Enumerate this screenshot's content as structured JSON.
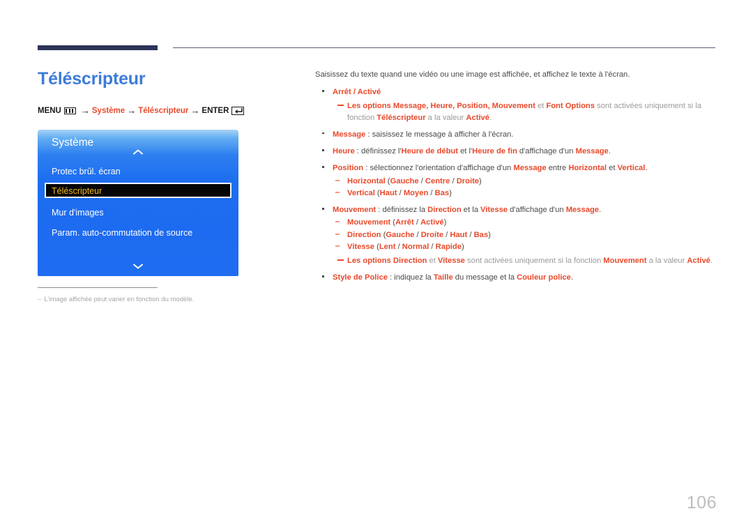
{
  "page_title": "Téléscripteur",
  "menu_path": {
    "menu_label": "MENU",
    "menu_icon": "menu-grid-icon",
    "arrow": "→",
    "step1": "Système",
    "step2": "Téléscripteur",
    "enter_label": "ENTER",
    "enter_icon": "enter-return-icon"
  },
  "osd": {
    "header": "Système",
    "chevron_up_icon": "chevron-up-icon",
    "chevron_down_icon": "chevron-down-icon",
    "items": [
      {
        "label": "Protec brûl. écran",
        "selected": false
      },
      {
        "label": "Téléscripteur",
        "selected": true
      },
      {
        "label": "Mur d'images",
        "selected": false
      },
      {
        "label": "Param. auto-commutation de source",
        "selected": false
      }
    ]
  },
  "footnote": {
    "dash": "‒",
    "text": "L'image affichée peut varier en fonction du modèle."
  },
  "content": {
    "intro": "Saisissez du texte quand une vidéo ou une image est affichée, et affichez le texte à l'écran.",
    "b1_title": "Arrêt / Activé",
    "note1_p1": "Les options Message",
    "note1_p2": ", ",
    "note1_p3": "Heure",
    "note1_p4": ", ",
    "note1_p5": "Position",
    "note1_p6": ", ",
    "note1_p7": "Mouvement",
    "note1_p8": " et ",
    "note1_p9": "Font Options",
    "note1_p10": " sont activées uniquement si la fonction ",
    "note1_p11": "Téléscripteur",
    "note1_p12": " a la valeur ",
    "note1_p13": "Activé",
    "note1_p14": ".",
    "b2_term": "Message",
    "b2_rest": " : saisissez le message à afficher à l'écran.",
    "b3_term": "Heure",
    "b3_t1": " : définissez l'",
    "b3_t2": "Heure de début",
    "b3_t3": " et l'",
    "b3_t4": "Heure de fin",
    "b3_t5": " d'affichage d'un ",
    "b3_t6": "Message",
    "b3_t7": ".",
    "b4_term": "Position",
    "b4_t1": " : sélectionnez l'orientation d'affichage d'un ",
    "b4_t2": "Message",
    "b4_t3": " entre ",
    "b4_t4": "Horizontal",
    "b4_t5": " et ",
    "b4_t6": "Vertical",
    "b4_t7": ".",
    "b4_s1_a": "Horizontal",
    "b4_s1_b": " (",
    "b4_s1_c": "Gauche",
    "b4_s1_d": " / ",
    "b4_s1_e": "Centre",
    "b4_s1_f": " / ",
    "b4_s1_g": "Droite",
    "b4_s1_h": ")",
    "b4_s2_a": "Vertical",
    "b4_s2_b": " (",
    "b4_s2_c": "Haut",
    "b4_s2_d": " / ",
    "b4_s2_e": "Moyen",
    "b4_s2_f": " / ",
    "b4_s2_g": "Bas",
    "b4_s2_h": ")",
    "b5_term": "Mouvement",
    "b5_t1": " : définissez la ",
    "b5_t2": "Direction",
    "b5_t3": " et la ",
    "b5_t4": "Vitesse",
    "b5_t5": " d'affichage d'un ",
    "b5_t6": "Message",
    "b5_t7": ".",
    "b5_s1_a": "Mouvement",
    "b5_s1_b": " (",
    "b5_s1_c": "Arrêt",
    "b5_s1_d": " / ",
    "b5_s1_e": "Activé",
    "b5_s1_f": ")",
    "b5_s2_a": "Direction",
    "b5_s2_b": " (",
    "b5_s2_c": "Gauche",
    "b5_s2_d": " / ",
    "b5_s2_e": "Droite",
    "b5_s2_f": " / ",
    "b5_s2_g": "Haut",
    "b5_s2_h": " / ",
    "b5_s2_i": "Bas",
    "b5_s2_j": ")",
    "b5_s3_a": "Vitesse",
    "b5_s3_b": " (",
    "b5_s3_c": "Lent",
    "b5_s3_d": " / ",
    "b5_s3_e": "Normal",
    "b5_s3_f": " / ",
    "b5_s3_g": "Rapide",
    "b5_s3_h": ")",
    "note2_p1": "Les options Direction",
    "note2_p2": " et ",
    "note2_p3": "Vitesse",
    "note2_p4": " sont activées uniquement si la fonction ",
    "note2_p5": "Mouvement",
    "note2_p6": " a la valeur ",
    "note2_p7": "Activé",
    "note2_p8": ".",
    "b6_term": "Style de Police",
    "b6_t1": " : indiquez la ",
    "b6_t2": "Taille",
    "b6_t3": " du message et la ",
    "b6_t4": "Couleur police",
    "b6_t5": "."
  },
  "page_number": "106",
  "colors": {
    "accent_red": "#e8492b",
    "title_blue": "#3d7cd8",
    "rule_navy": "#2e3459",
    "osd_blue": "#1d6bf0",
    "osd_selected_text": "#f3bc27",
    "page_number_gray": "#bdbdbd"
  }
}
